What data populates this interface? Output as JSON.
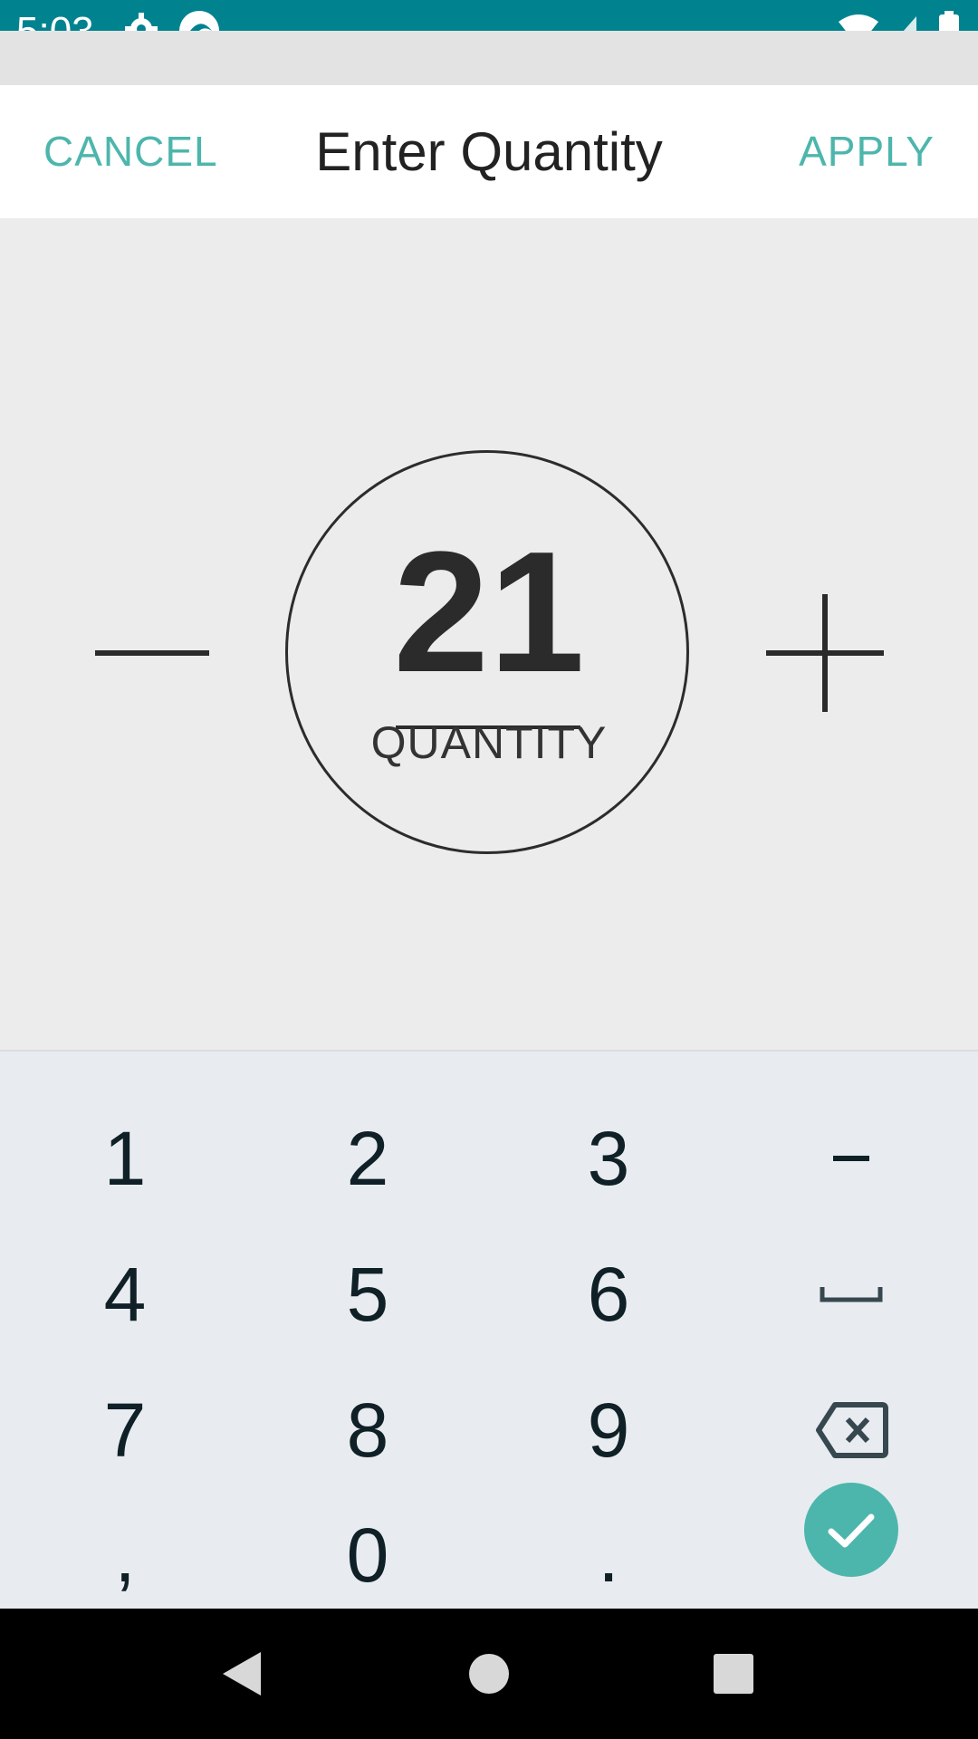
{
  "status_bar": {
    "time": "5:03",
    "icons": [
      "settings-icon",
      "app-icon",
      "wifi-icon",
      "signal-icon",
      "battery-icon"
    ],
    "color": "#00838f"
  },
  "dialog": {
    "title": "Enter Quantity",
    "cancel_label": "CANCEL",
    "apply_label": "APPLY",
    "accent_color": "#4db6ac"
  },
  "stepper": {
    "value": "21",
    "label": "QUANTITY",
    "decrement_icon": "minus-icon",
    "increment_icon": "plus-icon"
  },
  "keypad": {
    "row1": [
      "1",
      "2",
      "3"
    ],
    "row2": [
      "4",
      "5",
      "6"
    ],
    "row3": [
      "7",
      "8",
      "9"
    ],
    "row4": [
      ",",
      "0",
      "."
    ],
    "symbols": [
      "minus-key-icon",
      "space-key-icon",
      "backspace-icon",
      "check-icon"
    ]
  },
  "nav_bar": {
    "icons": [
      "back-icon",
      "home-icon",
      "recents-icon"
    ]
  }
}
